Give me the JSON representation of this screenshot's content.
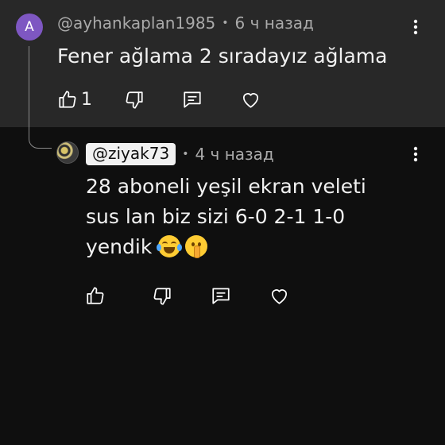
{
  "parent_comment": {
    "avatar_letter": "A",
    "author": "@ayhankaplan1985",
    "separator": "•",
    "time": "6 ч назад",
    "text": "Fener ağlama 2 sıradayız ağlama",
    "like_count": "1",
    "icons": [
      "like-icon",
      "dislike-icon",
      "reply-icon",
      "heart-icon",
      "more-vert-icon"
    ]
  },
  "reply_comment": {
    "author": "@ziyak73",
    "separator": "•",
    "time": "4 ч назад",
    "text_lines": [
      "28 aboneli yeşil ekran veleti",
      "sus lan biz sizi 6-0 2-1 1-0",
      "yendik"
    ],
    "emojis": [
      "laughing-tears-emoji",
      "shushing-face-emoji"
    ],
    "icons": [
      "like-icon",
      "dislike-icon",
      "reply-icon",
      "heart-icon",
      "more-vert-icon"
    ]
  },
  "colors": {
    "background": "#0f0f0f",
    "parent_background": "#282828",
    "avatar_purple": "#7e57c2",
    "meta_text": "#aaaaaa",
    "primary_text": "#f1f1f1"
  }
}
